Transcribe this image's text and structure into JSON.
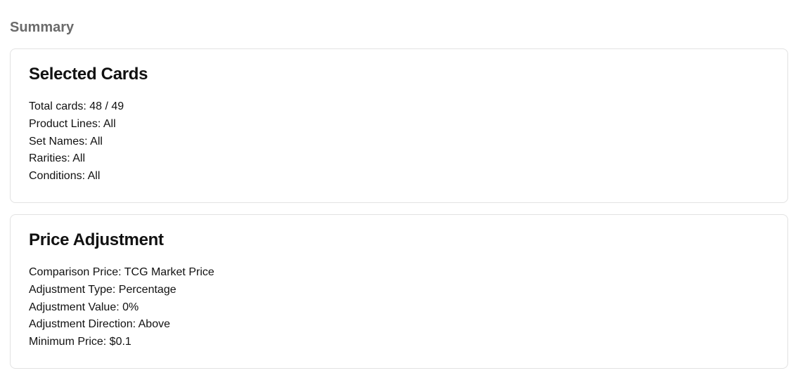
{
  "page_title": "Summary",
  "selected_cards": {
    "title": "Selected Cards",
    "rows": {
      "total_cards": "Total cards: 48 / 49",
      "product_lines": "Product Lines: All",
      "set_names": "Set Names: All",
      "rarities": "Rarities: All",
      "conditions": "Conditions: All"
    }
  },
  "price_adjustment": {
    "title": "Price Adjustment",
    "rows": {
      "comparison_price": "Comparison Price: TCG Market Price",
      "adjustment_type": "Adjustment Type: Percentage",
      "adjustment_value": "Adjustment Value: 0%",
      "adjustment_direction": "Adjustment Direction: Above",
      "minimum_price": "Minimum Price: $0.1"
    }
  }
}
